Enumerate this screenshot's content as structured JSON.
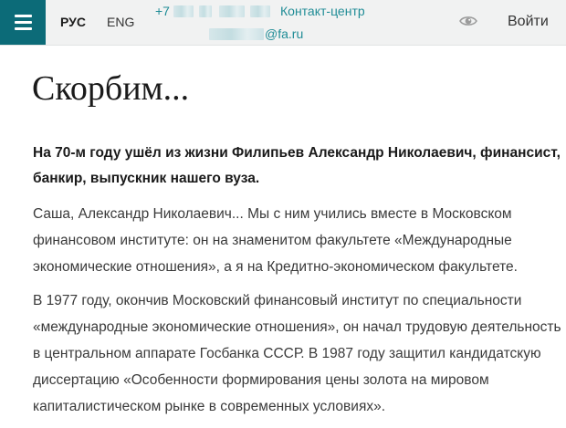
{
  "header": {
    "menu_icon": "hamburger-menu-icon",
    "languages": [
      {
        "label": "РУС",
        "active": true
      },
      {
        "label": "ENG",
        "active": false
      }
    ],
    "phone_prefix": "+7",
    "contact_label": "Контакт-центр",
    "email_suffix": "@fa.ru",
    "accessibility_icon": "eye-icon",
    "login_label": "Войти",
    "accent_color": "#0c6b78",
    "link_color": "#1f8c96"
  },
  "article": {
    "title": "Скорбим...",
    "lead": "На 70-м году ушёл из жизни Филипьев Александр Николаевич, финансист, банкир, выпускник нашего вуза.",
    "paragraphs": [
      "Саша, Александр Николаевич... Мы с ним учились вместе в Московском финансовом институте: он на знаменитом факультете «Международные экономические отношения», а я на Кредитно-экономическом факультете.",
      "В 1977 году, окончив Московский финансовый институт по специальности «международные экономические отношения», он начал трудовую деятельность в центральном аппарате Госбанка СССР. В 1987 году защитил кандидатскую диссертацию «Особенности формирования цены золота на мировом капиталистическом рынке в современных условиях»."
    ]
  }
}
